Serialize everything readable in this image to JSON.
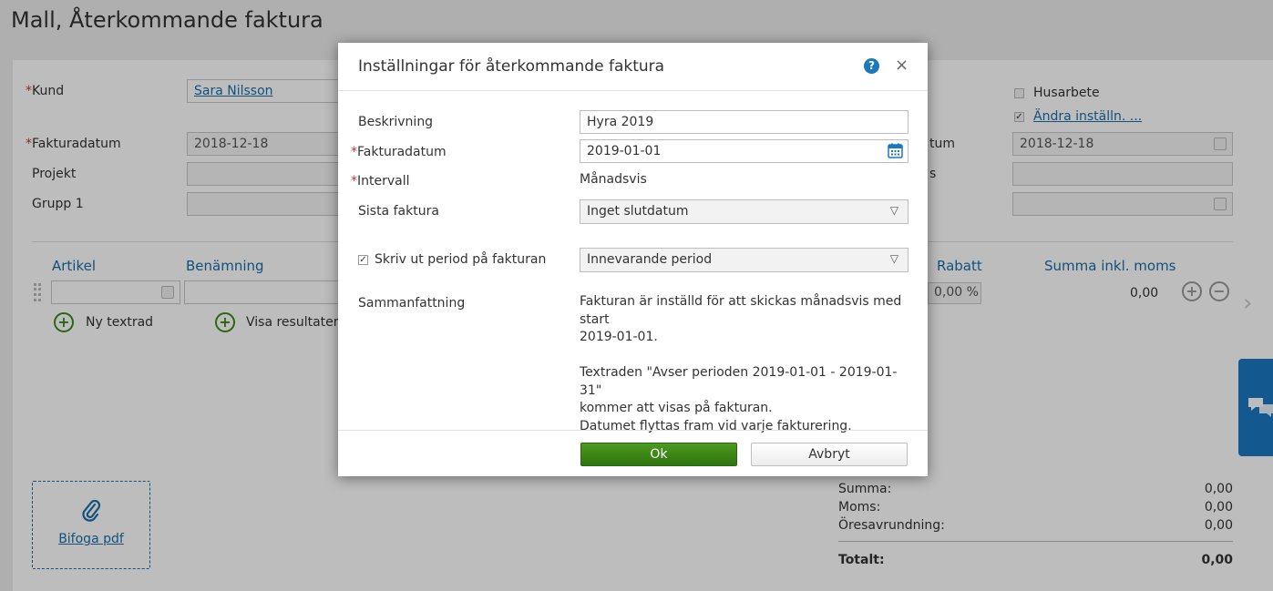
{
  "page": {
    "title": "Mall, Återkommande faktura"
  },
  "form": {
    "kund_label": "Kund",
    "kund_value": "Sara Nilsson",
    "fakturadatum_label": "Fakturadatum",
    "fakturadatum_value": "2018-12-18",
    "projekt_label": "Projekt",
    "grupp_label": "Grupp 1",
    "husarbete_label": "Husarbete",
    "andra_label": "Ändra inställn. ...",
    "right_label1": "tum",
    "right_date_value": "2018-12-18",
    "right_label2": "s"
  },
  "table": {
    "headers": {
      "artikel": "Artikel",
      "benamning": "Benämning",
      "rabatt": "Rabatt",
      "summa": "Summa inkl. moms"
    },
    "row": {
      "rabatt": "0,00 %",
      "summa": "0,00"
    },
    "ny_textrad": "Ny textrad",
    "visa": "Visa resultatenh"
  },
  "attach": {
    "label": "Bifoga pdf"
  },
  "totals": {
    "summa_label": "Summa:",
    "summa": "0,00",
    "moms_label": "Moms:",
    "moms": "0,00",
    "ores_label": "Öresavrundning:",
    "ores": "0,00",
    "totalt_label": "Totalt:",
    "totalt": "0,00"
  },
  "modal": {
    "title": "Inställningar för återkommande faktura",
    "help": "?",
    "close": "×",
    "beskrivning_label": "Beskrivning",
    "beskrivning_value": "Hyra 2019",
    "fakturadatum_label": "Fakturadatum",
    "fakturadatum_value": "2019-01-01",
    "intervall_label": "Intervall",
    "intervall_value": "Månadsvis",
    "sista_label": "Sista faktura",
    "sista_value": "Inget slutdatum",
    "skriv_label": "Skriv ut period på fakturan",
    "period_value": "Innevarande period",
    "sammanfattning_label": "Sammanfattning",
    "summary_line1": "Fakturan är inställd för att skickas månadsvis med start",
    "summary_line2": "2019-01-01.",
    "summary_line3": "Textraden \"Avser perioden 2019-01-01 - 2019-01-31\"",
    "summary_line4": "kommer att visas på fakturan.",
    "summary_line5": "Datumet flyttas fram vid varje fakturering.",
    "ok": "Ok",
    "cancel": "Avbryt"
  }
}
